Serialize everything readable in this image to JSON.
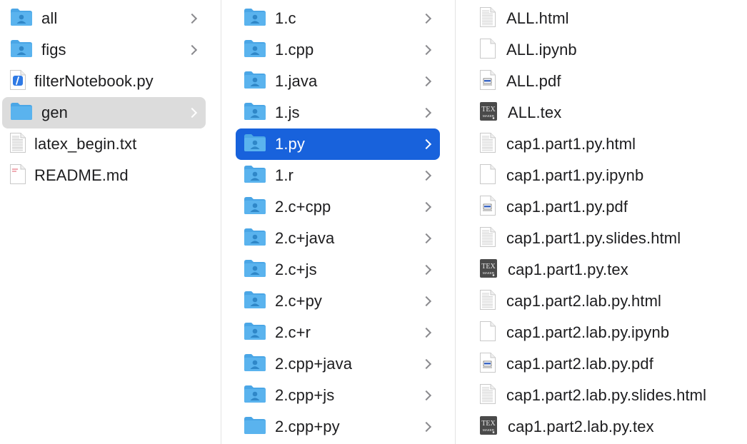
{
  "column1": {
    "items": [
      {
        "label": "all",
        "icon": "folder-user",
        "chevron": true,
        "selected": false
      },
      {
        "label": "figs",
        "icon": "folder-user",
        "chevron": true,
        "selected": false
      },
      {
        "label": "filterNotebook.py",
        "icon": "python-file",
        "chevron": false,
        "selected": false
      },
      {
        "label": "gen",
        "icon": "folder",
        "chevron": true,
        "selected": true
      },
      {
        "label": "latex_begin.txt",
        "icon": "text-file",
        "chevron": false,
        "selected": false
      },
      {
        "label": "README.md",
        "icon": "markdown-file",
        "chevron": false,
        "selected": false
      }
    ]
  },
  "column2": {
    "items": [
      {
        "label": "1.c",
        "icon": "folder-user",
        "chevron": true,
        "selected": false
      },
      {
        "label": "1.cpp",
        "icon": "folder-user",
        "chevron": true,
        "selected": false
      },
      {
        "label": "1.java",
        "icon": "folder-user",
        "chevron": true,
        "selected": false
      },
      {
        "label": "1.js",
        "icon": "folder-user",
        "chevron": true,
        "selected": false
      },
      {
        "label": "1.py",
        "icon": "folder-user",
        "chevron": true,
        "selected": true
      },
      {
        "label": "1.r",
        "icon": "folder-user",
        "chevron": true,
        "selected": false
      },
      {
        "label": "2.c+cpp",
        "icon": "folder-user",
        "chevron": true,
        "selected": false
      },
      {
        "label": "2.c+java",
        "icon": "folder-user",
        "chevron": true,
        "selected": false
      },
      {
        "label": "2.c+js",
        "icon": "folder-user",
        "chevron": true,
        "selected": false
      },
      {
        "label": "2.c+py",
        "icon": "folder-user",
        "chevron": true,
        "selected": false
      },
      {
        "label": "2.c+r",
        "icon": "folder-user",
        "chevron": true,
        "selected": false
      },
      {
        "label": "2.cpp+java",
        "icon": "folder-user",
        "chevron": true,
        "selected": false
      },
      {
        "label": "2.cpp+js",
        "icon": "folder-user",
        "chevron": true,
        "selected": false
      },
      {
        "label": "2.cpp+py",
        "icon": "folder",
        "chevron": true,
        "selected": false
      }
    ]
  },
  "column3": {
    "items": [
      {
        "label": "ALL.html",
        "icon": "html-file"
      },
      {
        "label": "ALL.ipynb",
        "icon": "blank-file"
      },
      {
        "label": "ALL.pdf",
        "icon": "pdf-file"
      },
      {
        "label": "ALL.tex",
        "icon": "tex-file"
      },
      {
        "label": "cap1.part1.py.html",
        "icon": "html-file"
      },
      {
        "label": "cap1.part1.py.ipynb",
        "icon": "blank-file"
      },
      {
        "label": "cap1.part1.py.pdf",
        "icon": "pdf-file"
      },
      {
        "label": "cap1.part1.py.slides.html",
        "icon": "html-file"
      },
      {
        "label": "cap1.part1.py.tex",
        "icon": "tex-file"
      },
      {
        "label": "cap1.part2.lab.py.html",
        "icon": "html-file"
      },
      {
        "label": "cap1.part2.lab.py.ipynb",
        "icon": "blank-file"
      },
      {
        "label": "cap1.part2.lab.py.pdf",
        "icon": "pdf-file"
      },
      {
        "label": "cap1.part2.lab.py.slides.html",
        "icon": "html-file"
      },
      {
        "label": "cap1.part2.lab.py.tex",
        "icon": "tex-file"
      }
    ]
  },
  "colors": {
    "selection_active": "#1862dc",
    "selection_inactive": "#dcdcdc",
    "folder": "#5ab3ee"
  }
}
